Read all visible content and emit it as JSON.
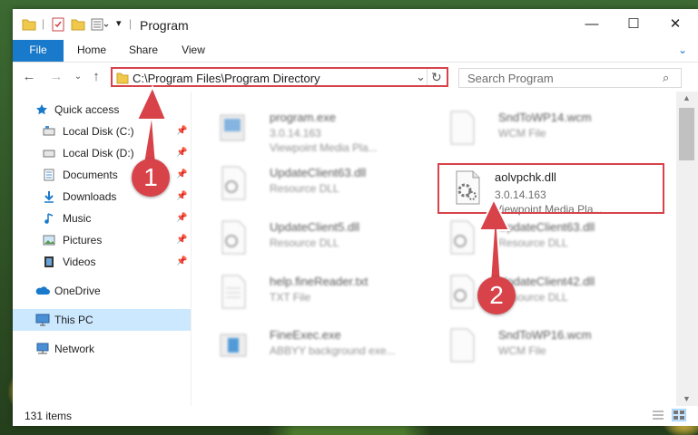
{
  "window": {
    "title": "Program"
  },
  "ribbon": {
    "tabs": [
      "File",
      "Home",
      "Share",
      "View"
    ]
  },
  "address": {
    "path": "C:\\Program Files\\Program Directory"
  },
  "search": {
    "placeholder": "Search Program"
  },
  "sidebar": {
    "quick_access": "Quick access",
    "items": [
      {
        "label": "Local Disk (C:)"
      },
      {
        "label": "Local Disk (D:)"
      },
      {
        "label": "Documents"
      },
      {
        "label": "Downloads"
      },
      {
        "label": "Music"
      },
      {
        "label": "Pictures"
      },
      {
        "label": "Videos"
      }
    ],
    "onedrive": "OneDrive",
    "this_pc": "This PC",
    "network": "Network"
  },
  "files": [
    {
      "name": "program.exe",
      "line1": "3.0.14.163",
      "line2": "Viewpoint Media Pla..."
    },
    {
      "name": "SndToWP14.wcm",
      "line1": "WCM File",
      "line2": ""
    },
    {
      "name": "UpdateClient63.dll",
      "line1": "Resource DLL",
      "line2": ""
    },
    {
      "name": "aolvpchk.dll",
      "line1": "3.0.14.163",
      "line2": "Viewpoint Media Pla..."
    },
    {
      "name": "UpdateClient5.dll",
      "line1": "Resource DLL",
      "line2": ""
    },
    {
      "name": "UpdateClient63.dll",
      "line1": "Resource DLL",
      "line2": ""
    },
    {
      "name": "help.fineReader.txt",
      "line1": "TXT File",
      "line2": ""
    },
    {
      "name": "UpdateClient42.dll",
      "line1": "Resource DLL",
      "line2": ""
    },
    {
      "name": "FineExec.exe",
      "line1": "ABBYY background exe...",
      "line2": ""
    },
    {
      "name": "SndToWP16.wcm",
      "line1": "WCM File",
      "line2": ""
    }
  ],
  "status": {
    "count": "131 items"
  },
  "annotations": {
    "step1": "1",
    "step2": "2"
  },
  "colors": {
    "accent": "#1979ca",
    "highlight": "#d8434a",
    "selection": "#cce8ff"
  }
}
